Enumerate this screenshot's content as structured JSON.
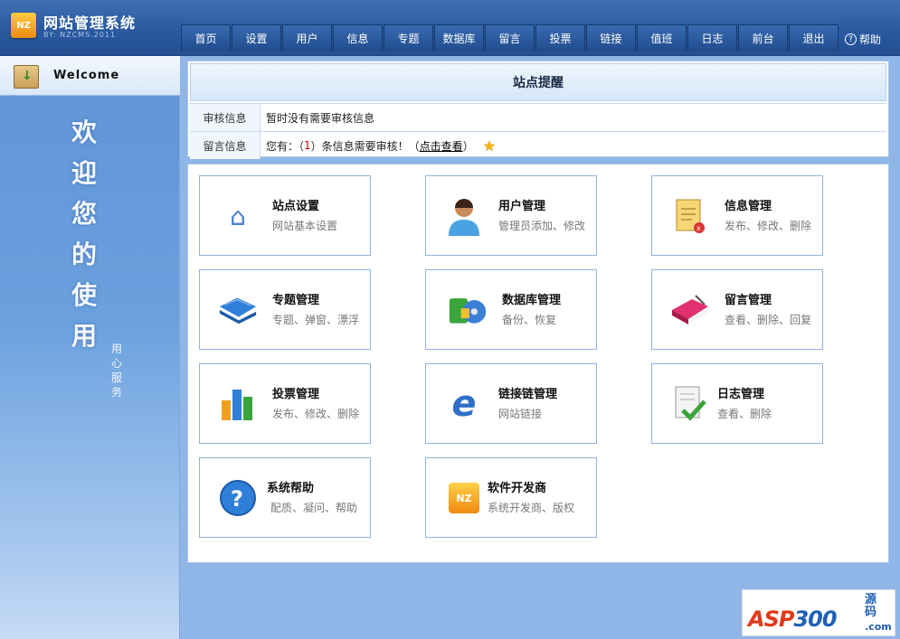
{
  "header": {
    "logo_text": "NZ",
    "title": "网站管理系统",
    "subtitle": "BY: NZCMS.2011",
    "nav": [
      "首页",
      "设置",
      "用户",
      "信息",
      "专题",
      "数据库",
      "留言",
      "投票",
      "链接",
      "值班",
      "日志",
      "前台",
      "退出"
    ],
    "help_label": "帮助"
  },
  "sidebar": {
    "welcome": "Welcome",
    "vertical_text": [
      "欢",
      "迎",
      "您",
      "的",
      "使",
      "用"
    ],
    "service_text": [
      "用",
      "心",
      "服",
      "务"
    ]
  },
  "notice": {
    "title": "站点提醒",
    "rows": [
      {
        "label": "审核信息",
        "value": "暂时没有需要审核信息"
      },
      {
        "label": "留言信息",
        "prefix": "您有：（",
        "count": "1",
        "middle": "）条信息需要审核！（",
        "link": "点击查看",
        "suffix": "）"
      }
    ]
  },
  "modules": [
    {
      "title": "站点设置",
      "desc": "网站基本设置",
      "icon": "house-icon"
    },
    {
      "title": "用户管理",
      "desc": "管理员添加、修改",
      "icon": "user-icon"
    },
    {
      "title": "信息管理",
      "desc": "发布、修改、删除",
      "icon": "document-icon"
    },
    {
      "title": "专题管理",
      "desc": "专题、弹窗、漂浮",
      "icon": "folder-icon"
    },
    {
      "title": "数据库管理",
      "desc": "备份、恢复",
      "icon": "database-icon"
    },
    {
      "title": "留言管理",
      "desc": "查看、删除、回复",
      "icon": "book-icon"
    },
    {
      "title": "投票管理",
      "desc": "发布、修改、删除",
      "icon": "bar-chart-icon"
    },
    {
      "title": "链接链管理",
      "desc": "网站链接",
      "icon": "browser-icon"
    },
    {
      "title": "日志管理",
      "desc": "查看、删除",
      "icon": "log-check-icon"
    },
    {
      "title": "系统帮助",
      "desc": "配质、凝问、帮助",
      "icon": "help-icon"
    },
    {
      "title": "软件开发商",
      "desc": "系统开发商、版权",
      "icon": "nz-logo-icon"
    }
  ],
  "watermark": {
    "main": "ASP",
    "num": "300",
    "sub": [
      "源",
      "码"
    ],
    "domain": ".com"
  }
}
